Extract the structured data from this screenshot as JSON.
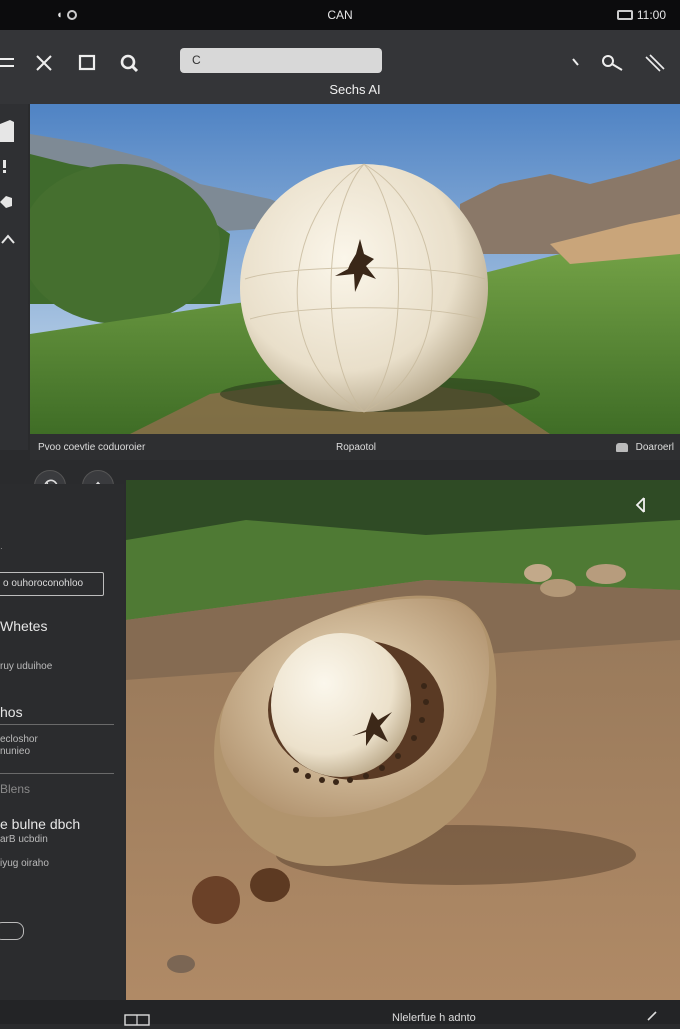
{
  "status_bar": {
    "title": "CAN",
    "right_text": "11:00"
  },
  "toolbar": {
    "search": {
      "value": "C"
    },
    "title": "Sechs AI",
    "icons": [
      "menu-icon",
      "close-icon",
      "square-icon",
      "search-icon",
      "search-key-icon",
      "pen-icon"
    ]
  },
  "panel1": {
    "caption_left": "Pvoo coevtie coduoroier",
    "caption_mid": "Ropaotol",
    "caption_right": "Doaroerl"
  },
  "sidebar": {
    "box_label": "o ouhoroconohloo",
    "heading1": "Whetes",
    "sub1": "ruy uduihoe",
    "heading2": "hos",
    "sub2": "ecloshor",
    "sub3": "nunieo",
    "heading3": "Blens",
    "heading4": "e bulne dbch",
    "sub4": "arB ucbdin",
    "sub5": "iyug oiraho",
    "bottom_left": "ɔɔ"
  },
  "bottom_bar": {
    "center_text": "Nlelerfue h adnto"
  }
}
